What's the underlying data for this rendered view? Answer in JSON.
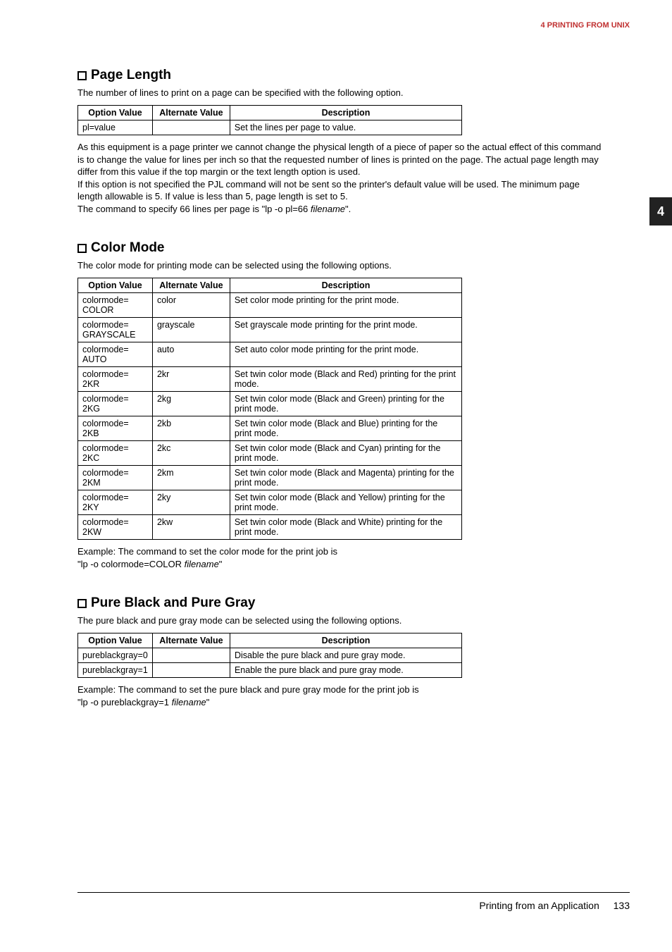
{
  "header": "4 PRINTING FROM UNIX",
  "sideTab": "4",
  "sections": {
    "pageLength": {
      "title": "Page Length",
      "intro": "The number of lines to print on a page can be specified with the following option.",
      "headers": [
        "Option Value",
        "Alternate Value",
        "Description"
      ],
      "rows": [
        {
          "opt": "pl=value",
          "alt": "",
          "desc": "Set the lines per page to value."
        }
      ],
      "after1": "As this equipment is a page printer we cannot change the physical length of a piece of paper so the actual effect of this command is to change the value for lines per inch so that the requested number of lines is printed on the page. The actual page length may differ from this value if the top margin or the text length option is used.",
      "after2": "If this option is not specified the PJL command will not be sent so the printer's default value will be used. The minimum page length allowable is 5. If value is less than 5, page length is set to 5.",
      "after3_pre": "The command to specify 66 lines per page is \"lp -o pl=66 ",
      "after3_italic": "filename",
      "after3_post": "\"."
    },
    "colorMode": {
      "title": "Color Mode",
      "intro": "The color mode for printing mode can be selected using the following options.",
      "headers": [
        "Option Value",
        "Alternate Value",
        "Description"
      ],
      "rows": [
        {
          "opt": "colormode=\nCOLOR",
          "alt": "color",
          "desc": "Set color mode printing for the print mode."
        },
        {
          "opt": "colormode=\nGRAYSCALE",
          "alt": "grayscale",
          "desc": "Set grayscale mode printing for the print mode."
        },
        {
          "opt": "colormode=\nAUTO",
          "alt": "auto",
          "desc": "Set auto color mode printing for the print mode."
        },
        {
          "opt": "colormode=\n2KR",
          "alt": "2kr",
          "desc": "Set twin color mode (Black and Red)  printing for the print mode."
        },
        {
          "opt": "colormode=\n2KG",
          "alt": "2kg",
          "desc": "Set twin color mode (Black and Green)  printing for the print mode."
        },
        {
          "opt": "colormode=\n2KB",
          "alt": "2kb",
          "desc": "Set twin color mode (Black and Blue)  printing for the print mode."
        },
        {
          "opt": "colormode=\n2KC",
          "alt": "2kc",
          "desc": "Set twin color mode (Black and Cyan)  printing for the print mode."
        },
        {
          "opt": "colormode=\n2KM",
          "alt": "2km",
          "desc": "Set twin color mode (Black and Magenta)  printing for the print mode."
        },
        {
          "opt": "colormode=\n2KY",
          "alt": "2ky",
          "desc": "Set twin color mode (Black and Yellow)  printing for the print mode."
        },
        {
          "opt": "colormode=\n2KW",
          "alt": "2kw",
          "desc": "Set twin color mode (Black and White)  printing for the print mode."
        }
      ],
      "example_line1": "Example: The command to set the color mode for the print job is",
      "example_line2_pre": "\"lp -o colormode=COLOR ",
      "example_line2_italic": "filename",
      "example_line2_post": "\""
    },
    "pureBlackGray": {
      "title": "Pure Black and Pure Gray",
      "intro": "The pure black and pure gray mode can be selected using the following options.",
      "headers": [
        "Option Value",
        "Alternate Value",
        "Description"
      ],
      "rows": [
        {
          "opt": "pureblackgray=0",
          "alt": "",
          "desc": "Disable the pure black and pure gray mode."
        },
        {
          "opt": "pureblackgray=1",
          "alt": "",
          "desc": "Enable the pure black and pure gray mode."
        }
      ],
      "example_line1": "Example: The command to set the pure black and pure gray mode for the print job is",
      "example_line2_pre": "\"lp -o pureblackgray=1 ",
      "example_line2_italic": "filename",
      "example_line2_post": "\""
    }
  },
  "footer": {
    "title": "Printing from an Application",
    "page": "133"
  }
}
